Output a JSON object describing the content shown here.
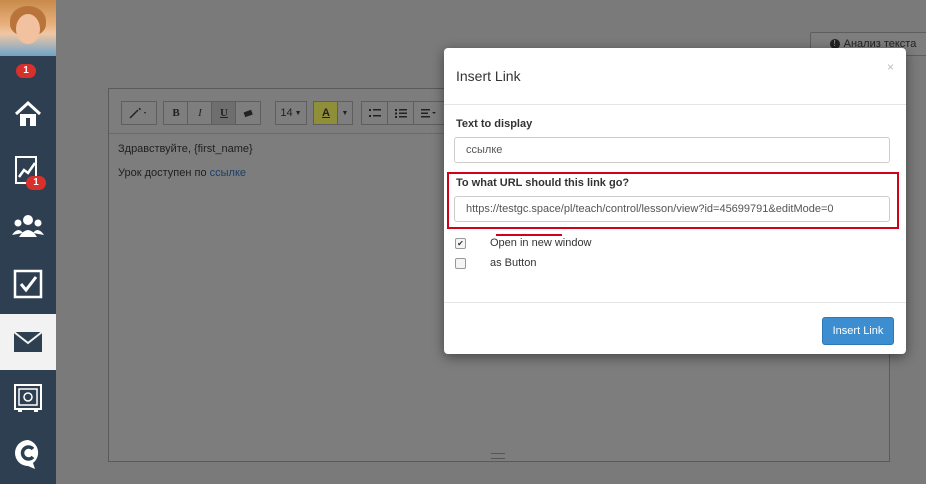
{
  "sidebar": {
    "avatar_badge": "1",
    "items": [
      {
        "icon": "home-icon"
      },
      {
        "icon": "chart-icon",
        "badge": "1"
      },
      {
        "icon": "users-icon"
      },
      {
        "icon": "checkbox-icon"
      },
      {
        "icon": "mail-icon",
        "active": true
      },
      {
        "icon": "safe-icon"
      },
      {
        "icon": "chat-logo-icon"
      }
    ]
  },
  "header": {
    "analyze_label": "Анализ текста"
  },
  "editor": {
    "toolbar": {
      "font_size": "14"
    },
    "line1": "Здравствуйте, {first_name}",
    "line2_text": "Урок доступен по ",
    "line2_link": "ссылке"
  },
  "modal": {
    "title": "Insert Link",
    "close": "×",
    "text_label": "Text to display",
    "text_value": "ссылке",
    "url_label": "To what URL should this link go?",
    "url_value": "https://testgc.space/pl/teach/control/lesson/view?id=45699791&editMode=0",
    "open_new_window_label": "Open in new window",
    "open_new_window_checked": true,
    "as_button_label": "as Button",
    "as_button_checked": false,
    "submit_label": "Insert Link"
  },
  "colors": {
    "sidebar_bg": "#2e3f52",
    "badge": "#d9302c",
    "primary": "#3d8ed1",
    "highlight": "#d0021b"
  }
}
